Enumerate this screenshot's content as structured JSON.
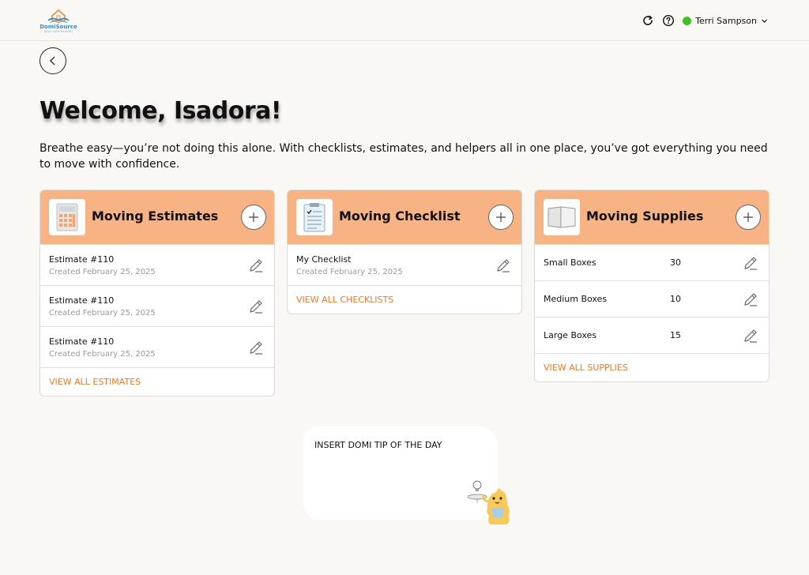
{
  "header": {
    "logo_brand": "DomiSource",
    "logo_tagline": "NEXT GEN MOVING",
    "user_name": "Terri Sampson",
    "user_status_color": "#3ec226",
    "icons": [
      "refresh-icon",
      "help-icon",
      "chevron-down-icon"
    ]
  },
  "main": {
    "welcome": "Welcome, Isadora!",
    "intro": "Breathe easy—you’re not doing this alone. With checklists, estimates, and helpers all in one place, you’ve got everything you need to move with confidence."
  },
  "estimates": {
    "title": "Moving Estimates",
    "items": [
      {
        "title": "Estimate #110",
        "sub": "Created February 25, 2025"
      },
      {
        "title": "Estimate #110",
        "sub": "Created February 25, 2025"
      },
      {
        "title": "Estimate #110",
        "sub": "Created February 25, 2025"
      }
    ],
    "view_all": "VIEW ALL ESTIMATES"
  },
  "checklist": {
    "title": "Moving Checklist",
    "items": [
      {
        "title": "My Checklist",
        "sub": "Created February 25, 2025"
      }
    ],
    "view_all": "VIEW ALL CHECKLISTS"
  },
  "supplies": {
    "title": "Moving Supplies",
    "items": [
      {
        "name": "Small Boxes",
        "qty": "30"
      },
      {
        "name": "Medium Boxes",
        "qty": "10"
      },
      {
        "name": "Large Boxes",
        "qty": "15"
      }
    ],
    "view_all": "VIEW ALL SUPPLIES"
  },
  "tip": {
    "text": "INSERT DOMI TIP OF THE DAY"
  },
  "colors": {
    "background": "#f9f8f5",
    "card_header": "#f7b384",
    "link": "#ea7a2a",
    "brand_blue": "#2f8fbf"
  }
}
